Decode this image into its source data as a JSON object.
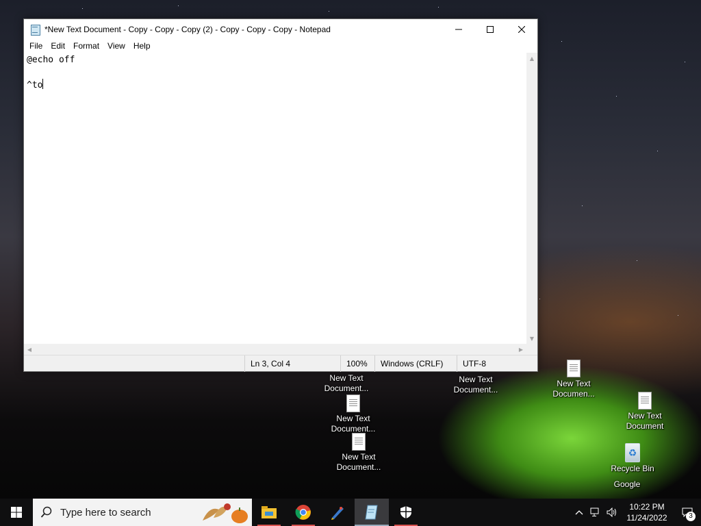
{
  "window": {
    "title": "*New Text Document - Copy - Copy - Copy (2) - Copy - Copy - Copy - Notepad",
    "menu": [
      "File",
      "Edit",
      "Format",
      "View",
      "Help"
    ]
  },
  "editor": {
    "lines": [
      "@echo off",
      "",
      "^to"
    ]
  },
  "statusbar": {
    "position": "Ln 3, Col 4",
    "zoom": "100%",
    "line_ending": "Windows (CRLF)",
    "encoding": "UTF-8"
  },
  "desktop_icons": [
    {
      "label": "New Text Document..."
    },
    {
      "label": "New Text Document..."
    },
    {
      "label": "New Text Document..."
    },
    {
      "label": "New Text Document..."
    },
    {
      "label": "New Text Documen..."
    },
    {
      "label": "New Text Document"
    },
    {
      "label": "Recycle Bin"
    },
    {
      "label": "Google"
    }
  ],
  "taskbar": {
    "search_placeholder": "Type here to search",
    "apps": [
      "file-explorer-icon",
      "chrome-icon",
      "paint-icon",
      "notepad-icon",
      "security-shield-icon"
    ],
    "clock_time": "10:22 PM",
    "clock_date": "11/24/2022",
    "notification_count": "3"
  }
}
